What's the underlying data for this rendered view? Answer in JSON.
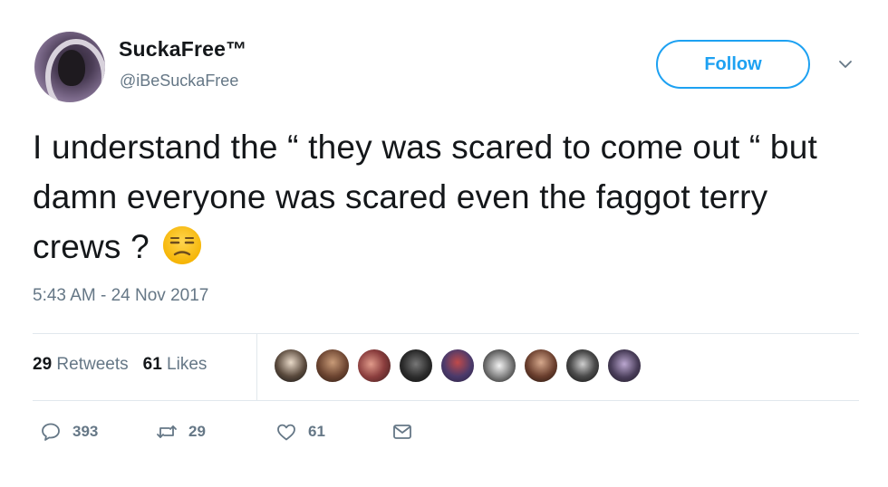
{
  "user": {
    "display_name": "SuckaFree™",
    "handle": "@iBeSuckaFree"
  },
  "follow_label": "Follow",
  "tweet": {
    "text": "I understand the “ they was scared to come out “ but damn everyone was scared even the faggot terry crews ?",
    "emoji": "unamused-face-icon"
  },
  "timestamp": "5:43 AM - 24 Nov 2017",
  "stats": {
    "retweets_count": "29",
    "retweets_label": "Retweets",
    "likes_count": "61",
    "likes_label": "Likes"
  },
  "likers_count_shown": 9,
  "actions": {
    "replies": "393",
    "retweets": "29",
    "likes": "61"
  },
  "colors": {
    "accent": "#1da1f2",
    "secondary_text": "#657786",
    "primary_text": "#14171a",
    "divider": "#e1e8ed"
  }
}
